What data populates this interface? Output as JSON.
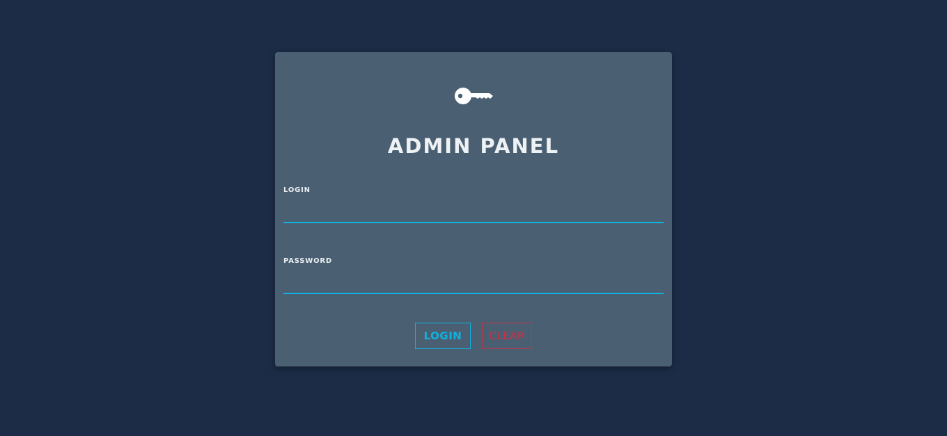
{
  "panel": {
    "icon": "key-icon",
    "title": "ADMIN PANEL"
  },
  "form": {
    "login_label": "LOGIN",
    "login_value": "",
    "password_label": "PASSWORD",
    "password_value": ""
  },
  "buttons": {
    "login_label": "LOGIN",
    "clear_label": "CLEAR"
  },
  "colors": {
    "background": "#1c2c47",
    "card": "#4a6072",
    "accent": "#10b2e0",
    "danger": "#c53349"
  }
}
